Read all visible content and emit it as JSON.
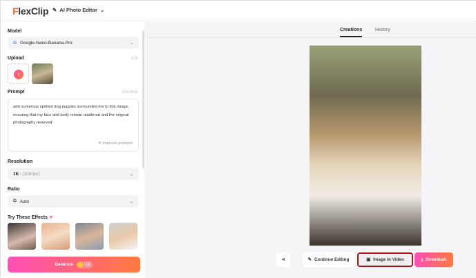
{
  "header": {
    "logo_prefix": "F",
    "logo_rest": "lexClip",
    "editor_label": "AI Photo Editor"
  },
  "sidebar": {
    "model_label": "Model",
    "model_value": "Google-Nano-Banana-Pro",
    "upload_label": "Upload",
    "upload_count": "1/10",
    "prompt_label": "Prompt",
    "prompt_count": "147/3000",
    "prompt_text": "add numerous spotted dog puppies surrounded me to this image, ensuring that my face and body remain unaltered and the original photography reserved",
    "improve_label": "Improve prompts",
    "resolution_label": "Resolution",
    "resolution_value": "1K",
    "resolution_sub": "(1080px)",
    "ratio_label": "Ratio",
    "ratio_value": "Auto",
    "effects_label": "Try These Effects",
    "generate_label": "Generate",
    "generate_cost": "-12"
  },
  "main": {
    "tabs": [
      {
        "label": "Creations",
        "active": true
      },
      {
        "label": "History",
        "active": false
      }
    ],
    "actions": {
      "continue": "Continue Editing",
      "image_to_video": "Image to Video",
      "download": "Download"
    }
  },
  "colors": {
    "accent_start": "#ff4fb8",
    "accent_end": "#ff7a3d",
    "highlight": "#b3141b"
  }
}
